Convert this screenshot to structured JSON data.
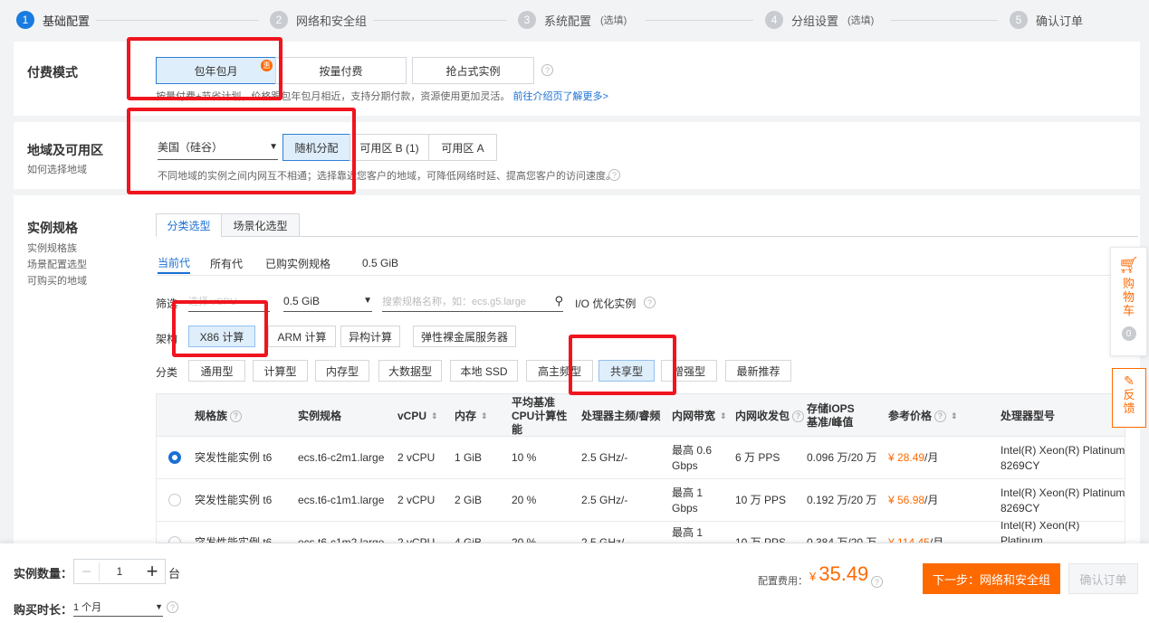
{
  "steps": [
    {
      "num": "1",
      "label": "基础配置",
      "optional": ""
    },
    {
      "num": "2",
      "label": "网络和安全组",
      "optional": ""
    },
    {
      "num": "3",
      "label": "系统配置",
      "optional": "(选填)"
    },
    {
      "num": "4",
      "label": "分组设置",
      "optional": "(选填)"
    },
    {
      "num": "5",
      "label": "确认订单",
      "optional": ""
    }
  ],
  "billing": {
    "title": "付费模式",
    "options": [
      "包年包月",
      "按量付费",
      "抢占式实例"
    ],
    "badge": "惠",
    "note": "按量付费+节省计划，价格跟包年包月相近，支持分期付款，资源使用更加灵活。",
    "note_link": "前往介绍页了解更多>"
  },
  "region": {
    "title": "地域及可用区",
    "subtitle": "如何选择地域",
    "selected_region": "美国（硅谷）",
    "zones": [
      "随机分配",
      "可用区 B (1)",
      "可用区 A"
    ],
    "note": "不同地域的实例之间内网互不相通；选择靠近您客户的地域，可降低网络时延、提高您客户的访问速度。"
  },
  "spec": {
    "title": "实例规格",
    "side_links": [
      "实例规格族",
      "场景配置选型",
      "可购买的地域"
    ],
    "tabs": [
      "分类选型",
      "场景化选型"
    ],
    "subtabs": [
      "当前代",
      "所有代",
      "已购实例规格",
      "0.5 GiB"
    ],
    "filter_label": "筛选",
    "cpu_placeholder": "选择 vCPU",
    "memory_value": "0.5 GiB",
    "search_placeholder": "搜索规格名称，如：ecs.g5.large",
    "io_label": "I/O 优化实例",
    "arch_label": "架构",
    "arch_options": [
      "X86 计算",
      "ARM 计算",
      "异构计算",
      "弹性裸金属服务器"
    ],
    "cat_label": "分类",
    "categories": [
      "通用型",
      "计算型",
      "内存型",
      "大数据型",
      "本地 SSD",
      "高主频型",
      "共享型",
      "增强型",
      "最新推荐"
    ]
  },
  "table": {
    "headers": [
      "规格族",
      "实例规格",
      "vCPU",
      "内存",
      "平均基准CPU计算性能",
      "处理器主频/睿频",
      "内网带宽",
      "内网收发包",
      "存储IOPS 基准/峰值",
      "参考价格",
      "处理器型号"
    ],
    "rows": [
      {
        "family": "突发性能实例 t6",
        "spec": "ecs.t6-c2m1.large",
        "vcpu": "2 vCPU",
        "mem": "1 GiB",
        "perf": "10 %",
        "freq": "2.5 GHz/-",
        "bw": "最高 0.6 Gbps",
        "pps": "6 万 PPS",
        "iops": "0.096 万/20 万",
        "price": "¥ 28.49",
        "unit": " /月",
        "cpu": "Intel(R) Xeon(R) Platinum 8269CY"
      },
      {
        "family": "突发性能实例 t6",
        "spec": "ecs.t6-c1m1.large",
        "vcpu": "2 vCPU",
        "mem": "2 GiB",
        "perf": "20 %",
        "freq": "2.5 GHz/-",
        "bw": "最高 1 Gbps",
        "pps": "10 万 PPS",
        "iops": "0.192 万/20 万",
        "price": "¥ 56.98",
        "unit": " /月",
        "cpu": "Intel(R) Xeon(R) Platinum 8269CY"
      },
      {
        "family": "突发性能实例 t6",
        "spec": "ecs.t6-c1m2.large",
        "vcpu": "2 vCPU",
        "mem": "4 GiB",
        "perf": "20 %",
        "freq": "2.5 GHz/-",
        "bw": "最高 1",
        "pps": "10 万 PPS",
        "iops": "0.384 万/20 万",
        "price": "¥ 114.45",
        "unit": " /月",
        "cpu": "Intel(R) Xeon(R) Platinum"
      }
    ]
  },
  "float": {
    "cart": [
      "购",
      "物",
      "车"
    ],
    "cart_count": "0",
    "feedback": [
      "反",
      "馈"
    ]
  },
  "bottom": {
    "qty_label": "实例数量：",
    "qty": "1",
    "qty_unit": "台",
    "duration_label": "购买时长：",
    "duration": "1 个月",
    "cost_label": "配置费用：",
    "currency": "¥",
    "cost": "35.49",
    "next": "下一步：网络和安全组",
    "confirm": "确认订单"
  }
}
